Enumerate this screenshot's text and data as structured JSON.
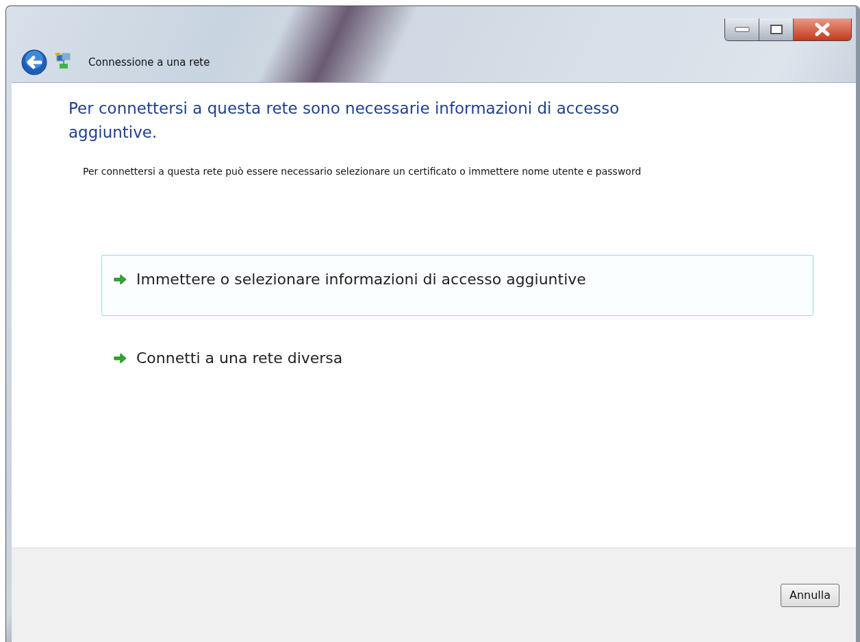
{
  "window": {
    "title": "Connessione a una rete"
  },
  "heading": "Per connettersi a questa rete sono necessarie informazioni di accesso aggiuntive.",
  "description": "Per connettersi a questa rete può essere necessario selezionare un certificato o immettere nome utente e password",
  "options": [
    {
      "label": "Immettere o selezionare informazioni di accesso aggiuntive",
      "selected": true
    },
    {
      "label": "Connetti a una rete diversa",
      "selected": false
    }
  ],
  "buttons": [
    "Annulla"
  ]
}
